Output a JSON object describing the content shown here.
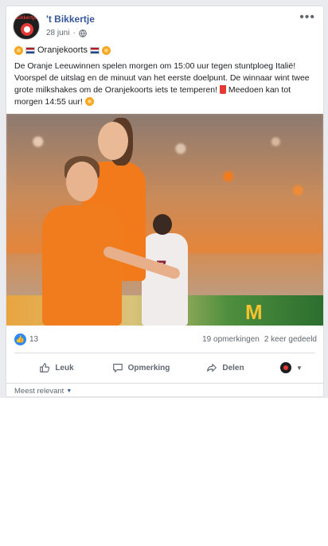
{
  "post": {
    "page_name": "'t Bikkertje",
    "date": "28 juni",
    "avatar_text": "Bikkertje",
    "title_text": "Oranjekoorts",
    "body_text": "De Oranje Leeuwinnen spelen morgen om 15:00 uur tegen stuntploeg Italië! Voorspel de uitslag en de minuut van het eerste doelpunt. De winnaar wint twee grote milkshakes om de Oranjekoorts iets te temperen!",
    "body_text_end": " Meedoen kan tot morgen 14:55 uur!",
    "image_text": {
      "jersey_number": "7",
      "sponsor": "M"
    }
  },
  "stats": {
    "like_count": "13",
    "comments": "19 opmerkingen",
    "shares": "2 keer gedeeld"
  },
  "actions": {
    "like": "Leuk",
    "comment": "Opmerking",
    "share": "Delen"
  },
  "comments": {
    "sort_label": "Meest relevant"
  },
  "icons": {
    "more": "more-icon",
    "globe": "globe-icon",
    "like": "thumbs-up-icon",
    "comment": "comment-icon",
    "share": "share-icon"
  },
  "colors": {
    "link": "#385898",
    "like_blue": "#2d88ff",
    "muted": "#606770"
  }
}
